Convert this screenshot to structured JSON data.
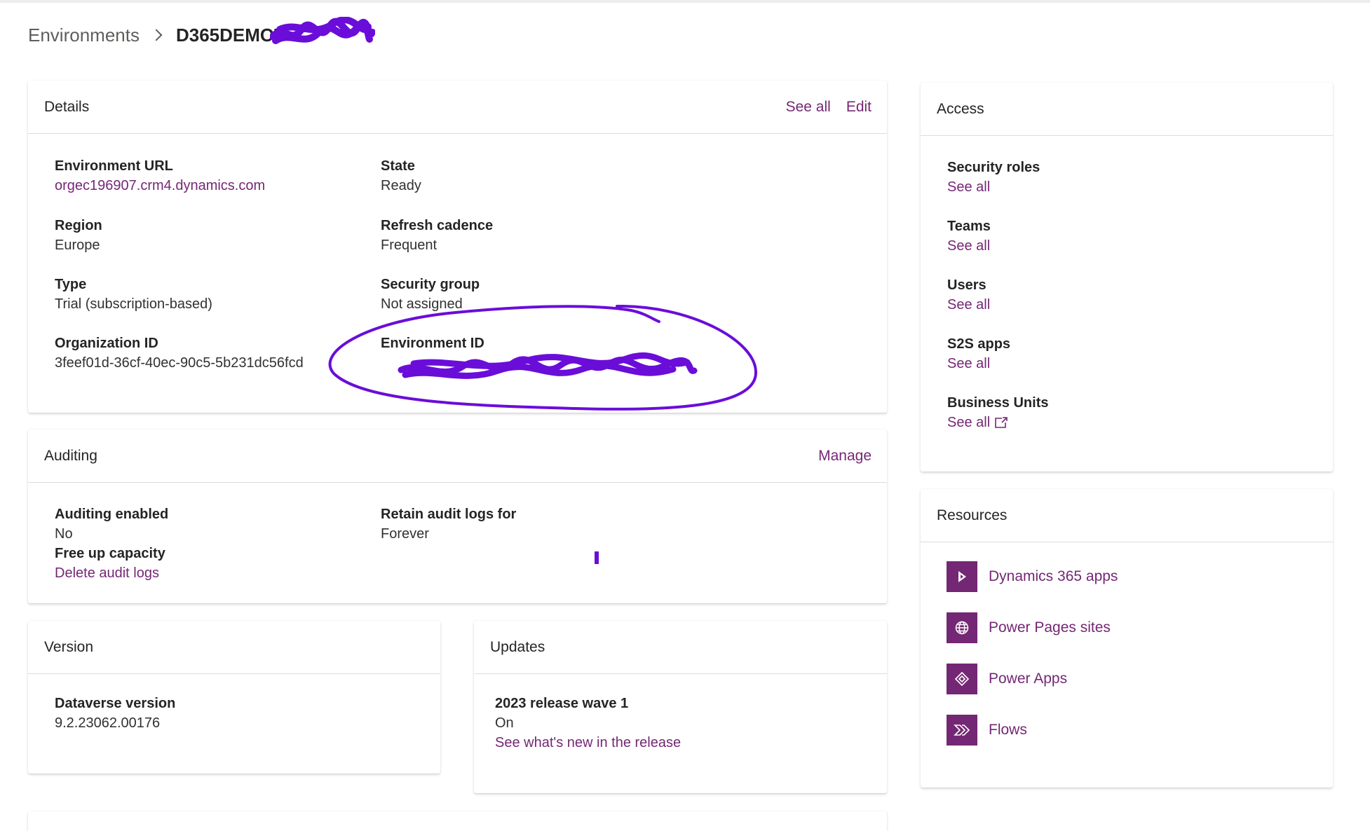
{
  "breadcrumb": {
    "root": "Environments",
    "current": "D365DEMOT"
  },
  "details": {
    "title": "Details",
    "see_all": "See all",
    "edit": "Edit",
    "environment_url": {
      "label": "Environment URL",
      "value": "orgec196907.crm4.dynamics.com"
    },
    "state": {
      "label": "State",
      "value": "Ready"
    },
    "region": {
      "label": "Region",
      "value": "Europe"
    },
    "refresh_cadence": {
      "label": "Refresh cadence",
      "value": "Frequent"
    },
    "type": {
      "label": "Type",
      "value": "Trial (subscription-based)"
    },
    "security_group": {
      "label": "Security group",
      "value": "Not assigned"
    },
    "organization_id": {
      "label": "Organization ID",
      "value": "3feef01d-36cf-40ec-90c5-5b231dc56fcd"
    },
    "environment_id": {
      "label": "Environment ID",
      "value": ""
    }
  },
  "auditing": {
    "title": "Auditing",
    "manage": "Manage",
    "auditing_enabled": {
      "label": "Auditing enabled",
      "value": "No"
    },
    "retain_logs": {
      "label": "Retain audit logs for",
      "value": "Forever"
    },
    "free_up": {
      "label": "Free up capacity",
      "link": "Delete audit logs"
    }
  },
  "version": {
    "title": "Version",
    "dataverse": {
      "label": "Dataverse version",
      "value": "9.2.23062.00176"
    }
  },
  "updates": {
    "title": "Updates",
    "release": {
      "label": "2023 release wave 1",
      "value": "On",
      "link": "See what's new in the release"
    }
  },
  "access": {
    "title": "Access",
    "items": [
      {
        "label": "Security roles",
        "link": "See all"
      },
      {
        "label": "Teams",
        "link": "See all"
      },
      {
        "label": "Users",
        "link": "See all"
      },
      {
        "label": "S2S apps",
        "link": "See all"
      },
      {
        "label": "Business Units",
        "link": "See all"
      }
    ]
  },
  "resources": {
    "title": "Resources",
    "items": [
      {
        "label": "Dynamics 365 apps",
        "icon": "dynamics-365-icon"
      },
      {
        "label": "Power Pages sites",
        "icon": "globe-icon"
      },
      {
        "label": "Power Apps",
        "icon": "power-apps-icon"
      },
      {
        "label": "Flows",
        "icon": "flows-icon"
      }
    ]
  },
  "colors": {
    "accent": "#742774",
    "annotation": "#6a0dd9"
  }
}
